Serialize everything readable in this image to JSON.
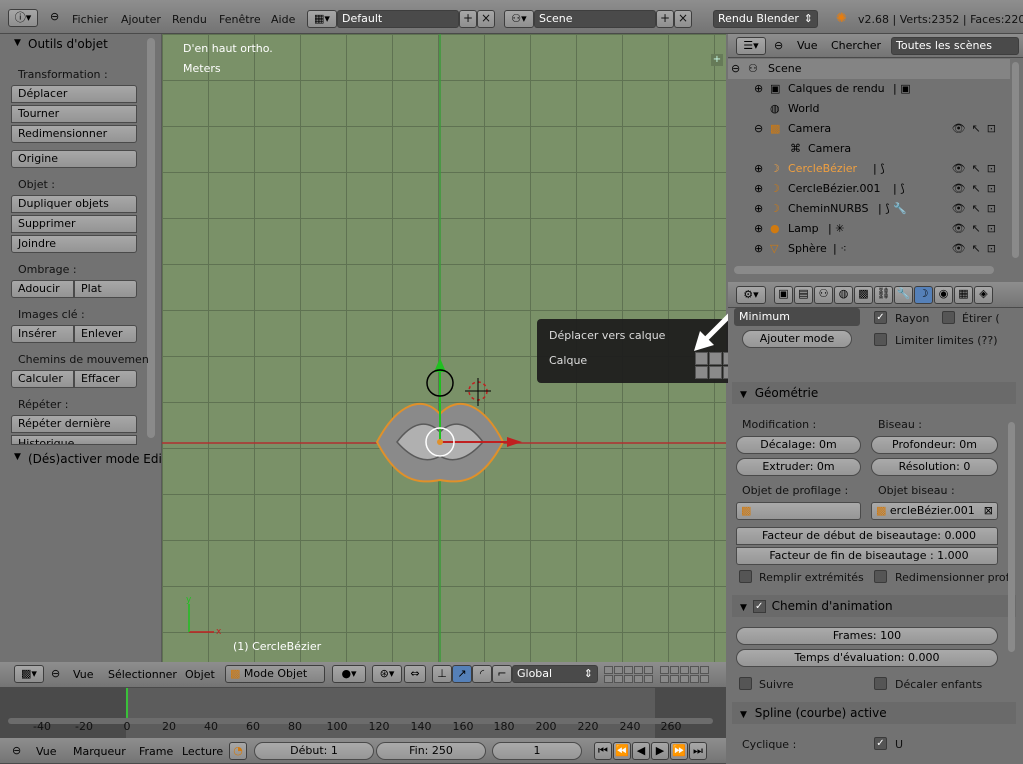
{
  "top_header": {
    "menus": [
      "Fichier",
      "Ajouter",
      "Rendu",
      "Fenêtre",
      "Aide"
    ],
    "layout": "Default",
    "scene": "Scene",
    "engine": "Rendu Blender",
    "stats": "v2.68 | Verts:2352 | Faces:2205"
  },
  "tools_panel": {
    "title": "Outils d'objet",
    "transformation_label": "Transformation :",
    "deplacer": "Déplacer",
    "tourner": "Tourner",
    "redimensionner": "Redimensionner",
    "origine": "Origine",
    "objet_label": "Objet :",
    "dupliquer": "Dupliquer objets",
    "supprimer": "Supprimer",
    "joindre": "Joindre",
    "ombrage_label": "Ombrage :",
    "adoucir": "Adoucir",
    "plat": "Plat",
    "images_cle_label": "Images clé :",
    "inserer": "Insérer",
    "enlever": "Enlever",
    "chemins_label": "Chemins de mouvemen",
    "calculer": "Calculer",
    "effacer": "Effacer",
    "repeter_label": "Répéter :",
    "repeter_derniere": "Répéter dernière",
    "historique": "Historique...",
    "toggle_edit": "(Dés)activer mode Edit"
  },
  "viewport": {
    "view_name": "D'en haut ortho.",
    "units": "Meters",
    "object_label": "(1) CercleBézier"
  },
  "popup": {
    "title": "Déplacer vers calque",
    "calque": "Calque"
  },
  "viewport_header": {
    "vue": "Vue",
    "selectionner": "Sélectionner",
    "objet": "Objet",
    "mode": "Mode Objet",
    "orientation": "Global"
  },
  "timeline": {
    "ticks": [
      "-40",
      "-20",
      "0",
      "20",
      "40",
      "60",
      "80",
      "100",
      "120",
      "140",
      "160",
      "180",
      "200",
      "220",
      "240",
      "260"
    ],
    "vue": "Vue",
    "marqueur": "Marqueur",
    "frame": "Frame",
    "lecture": "Lecture",
    "debut": "Début: 1",
    "fin": "Fin: 250",
    "current": "1"
  },
  "outliner": {
    "vue": "Vue",
    "chercher": "Chercher",
    "scope": "Toutes les scènes",
    "items": [
      {
        "name": "Scene"
      },
      {
        "name": "Calques de rendu"
      },
      {
        "name": "World"
      },
      {
        "name": "Camera"
      },
      {
        "name": "Camera"
      },
      {
        "name": "CercleBézier"
      },
      {
        "name": "CercleBézier.001"
      },
      {
        "name": "CheminNURBS"
      },
      {
        "name": "Lamp"
      },
      {
        "name": "Sphère"
      }
    ]
  },
  "properties": {
    "minimum": "Minimum",
    "rayon": "Rayon",
    "etirer": "Étirer (",
    "limiter": "Limiter limites (??)",
    "ajouter_mode": "Ajouter mode",
    "geometrie": "Géométrie",
    "modification": "Modification :",
    "biseau": "Biseau :",
    "decalage": "Décalage: 0m",
    "profondeur": "Profondeur: 0m",
    "extruder": "Extruder: 0m",
    "resolution": "Résolution: 0",
    "objet_profilage": "Objet de profilage :",
    "objet_biseau": "Objet biseau :",
    "biseau_obj": "ercleBézier.001",
    "facteur_debut": "Facteur de début de biseautage: 0.000",
    "facteur_fin": "Facteur de fin de biseautage : 1.000",
    "remplir": "Remplir extrémités",
    "redim_prof": "Redimensionner prof",
    "chemin_anim": "Chemin d'animation",
    "frames": "Frames: 100",
    "temps_eval": "Temps d'évaluation: 0.000",
    "suivre": "Suivre",
    "decaler": "Décaler enfants",
    "spline": "Spline (courbe) active",
    "cyclique": "Cyclique :",
    "u": "U"
  }
}
